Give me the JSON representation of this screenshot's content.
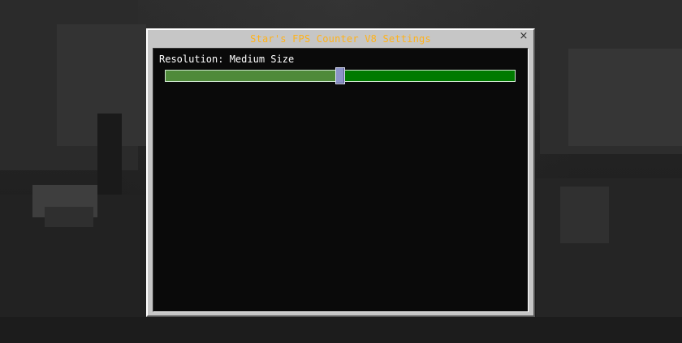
{
  "dialog": {
    "title": "Star's FPS Counter V8 Settings",
    "close_label": "×"
  },
  "setting": {
    "label": "Resolution: Medium Size",
    "slider_value": 0.5
  },
  "colors": {
    "title": "#ffb21a",
    "slider_track": "#007a00",
    "slider_fill": "#4f8a3a",
    "slider_thumb": "#8c93c8",
    "panel_background": "#0a0a0a",
    "frame": "#c6c6c6"
  },
  "icons": {
    "close": "close-icon"
  }
}
